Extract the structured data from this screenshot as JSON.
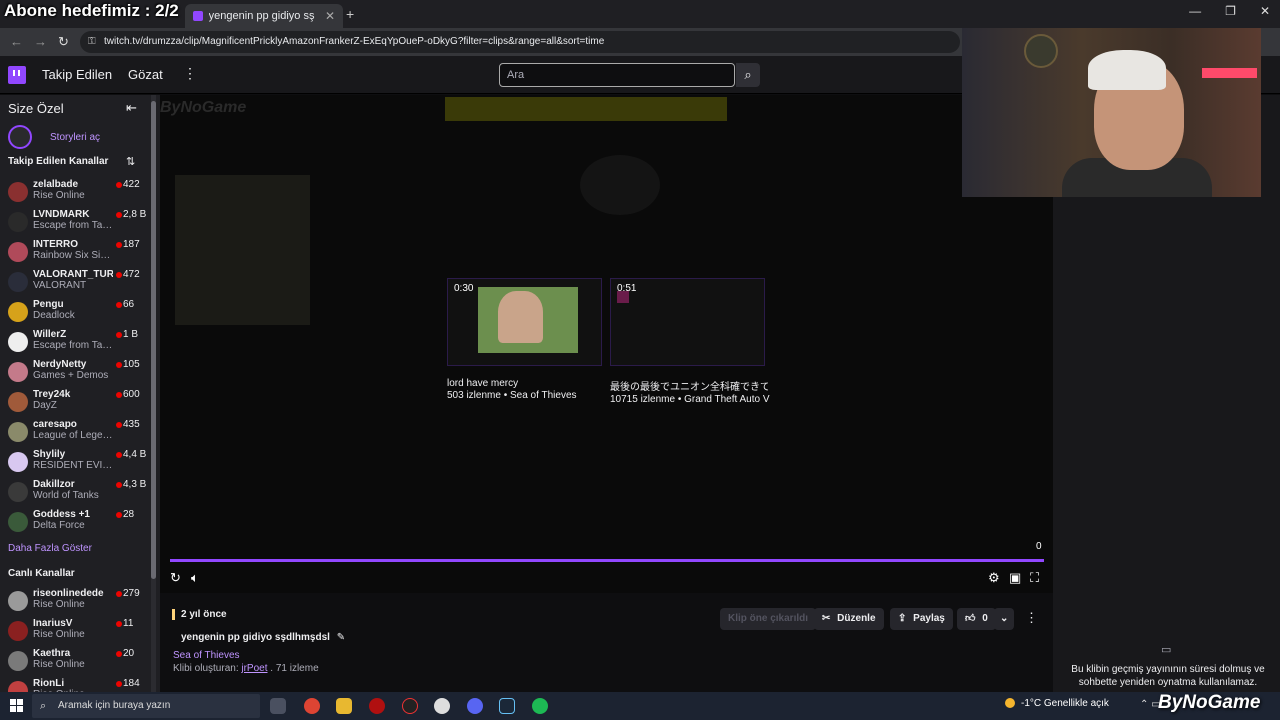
{
  "overlay": {
    "subscriber_goal": "Abone hedefimiz : 2/2"
  },
  "browser": {
    "tabs": [
      {
        "label": "yengenin pp gidiyo sşdlhmşdsl",
        "active": true
      }
    ],
    "url": "twitch.tv/drumzza/clip/MagnificentPricklyAmazonFrankerZ-ExEqYpOueP-oDkyG?filter=clips&range=all&sort=time"
  },
  "topnav": {
    "following": "Takip Edilen",
    "browse": "Gözat",
    "search_placeholder": "Ara"
  },
  "sidebar": {
    "header": "Size Özel",
    "stories": "Storyleri aç",
    "followed_title": "Takip Edilen Kanallar",
    "followed": [
      {
        "name": "zelalbade",
        "game": "Rise Online",
        "viewers": "422",
        "color": "#8a3030"
      },
      {
        "name": "LVNDMARK",
        "game": "Escape from Tarkov",
        "viewers": "2,8 B",
        "color": "#2a2a2a"
      },
      {
        "name": "INTERRO",
        "game": "Rainbow Six Siege",
        "viewers": "187",
        "color": "#b04a5a"
      },
      {
        "name": "VALORANT_TUR",
        "game": "VALORANT",
        "viewers": "472",
        "color": "#2a2d3a"
      },
      {
        "name": "Pengu",
        "game": "Deadlock",
        "viewers": "66",
        "color": "#d6a21a"
      },
      {
        "name": "WillerZ",
        "game": "Escape from Tarkov",
        "viewers": "1 B",
        "color": "#eeeeee"
      },
      {
        "name": "NerdyNetty",
        "game": "Games + Demos",
        "viewers": "105",
        "color": "#c47a8a"
      },
      {
        "name": "Trey24k",
        "game": "DayZ",
        "viewers": "600",
        "color": "#a05a3a"
      },
      {
        "name": "caresapo",
        "game": "League of Legends",
        "viewers": "435",
        "color": "#8a8a6a"
      },
      {
        "name": "Shylily",
        "game": "RESIDENT EVIL 4",
        "viewers": "4,4 B",
        "color": "#d8c8f0"
      },
      {
        "name": "Dakillzor",
        "game": "World of Tanks",
        "viewers": "4,3 B",
        "color": "#3a3a3a"
      },
      {
        "name": "Goddess +1",
        "game": "Delta Force",
        "viewers": "28",
        "color": "#3a5a3a"
      }
    ],
    "show_more": "Daha Fazla Göster",
    "live_title": "Canlı Kanallar",
    "live": [
      {
        "name": "riseonlinedede",
        "game": "Rise Online",
        "viewers": "279",
        "color": "#9a9a9a"
      },
      {
        "name": "InariusV",
        "game": "Rise Online",
        "viewers": "11",
        "color": "#8a2020"
      },
      {
        "name": "Kaethra",
        "game": "Rise Online",
        "viewers": "20",
        "color": "#7a7a7a"
      },
      {
        "name": "RionLi",
        "game": "Rise Online",
        "viewers": "184",
        "color": "#c04040"
      }
    ]
  },
  "player": {
    "watermark": "ByNoGame",
    "suggestions": [
      {
        "duration": "0:30",
        "title": "lord have mercy",
        "meta": "503 izlenme • Sea of Thieves"
      },
      {
        "duration": "0:51",
        "title": "最後の最後でユニオン全科確できて...",
        "meta": "10715 izlenme • Grand Theft Auto V"
      }
    ],
    "countdown": "0"
  },
  "clip": {
    "time_ago": "2 yıl önce",
    "title": "yengenin pp gidiyo sşdlhmşdsl",
    "game": "Sea of Thieves",
    "creator_prefix": "Klibi oluşturan:",
    "creator": "jrPoet",
    "views": ". 71 izleme",
    "feature": "Klip öne çıkarıldı",
    "edit": "Düzenle",
    "share": "Paylaş",
    "likes": "0"
  },
  "chat": {
    "message": "Bu klibin geçmiş yayınının süresi dolmuş ve sohbette yeniden oynatma kullanılamaz."
  },
  "taskbar": {
    "search_placeholder": "Aramak için buraya yazın",
    "weather": "-1°C  Genellikle açık",
    "brand": "ByNoGame"
  }
}
